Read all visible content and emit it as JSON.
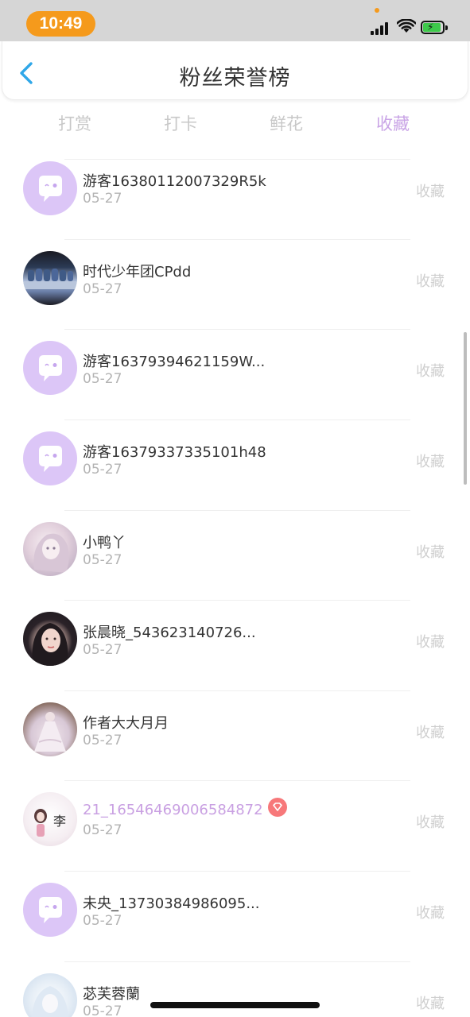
{
  "status_bar": {
    "time": "10:49"
  },
  "header": {
    "title": "粉丝荣誉榜"
  },
  "tabs": [
    {
      "label": "打赏",
      "active": false
    },
    {
      "label": "打卡",
      "active": false
    },
    {
      "label": "鲜花",
      "active": false
    },
    {
      "label": "收藏",
      "active": true
    }
  ],
  "colors": {
    "accent_purple": "#c9a4e6",
    "status_pill": "#f59a1c",
    "avatar_bubble": "#dcc6f7",
    "vip_badge": "#f7787a"
  },
  "items": [
    {
      "name": "游客16380112007329R5k",
      "date": "05-27",
      "action": "收藏",
      "avatar": "chat-bubble-avatar",
      "vip": false
    },
    {
      "name": "时代少年团CPdd",
      "date": "05-27",
      "action": "收藏",
      "avatar": "group-photo-avatar",
      "vip": false
    },
    {
      "name": "游客16379394621159W...",
      "date": "05-27",
      "action": "收藏",
      "avatar": "chat-bubble-avatar",
      "vip": false
    },
    {
      "name": "游客16379337335101h48",
      "date": "05-27",
      "action": "收藏",
      "avatar": "chat-bubble-avatar",
      "vip": false
    },
    {
      "name": "小鸭丫",
      "date": "05-27",
      "action": "收藏",
      "avatar": "anime-girl-avatar",
      "vip": false
    },
    {
      "name": "张晨晓_543623140726...",
      "date": "05-27",
      "action": "收藏",
      "avatar": "portrait-avatar",
      "vip": false
    },
    {
      "name": "作者大大月月",
      "date": "05-27",
      "action": "收藏",
      "avatar": "dress-avatar",
      "vip": false
    },
    {
      "name": "21_16546469006584872",
      "date": "05-27",
      "action": "收藏",
      "avatar": "illustration-avatar",
      "vip": true
    },
    {
      "name": "未央_13730384986095...",
      "date": "05-27",
      "action": "收藏",
      "avatar": "chat-bubble-avatar",
      "vip": false
    },
    {
      "name": "苾芙蓉蘭",
      "date": "05-27",
      "action": "收藏",
      "avatar": "snow-girl-avatar",
      "vip": false
    }
  ]
}
